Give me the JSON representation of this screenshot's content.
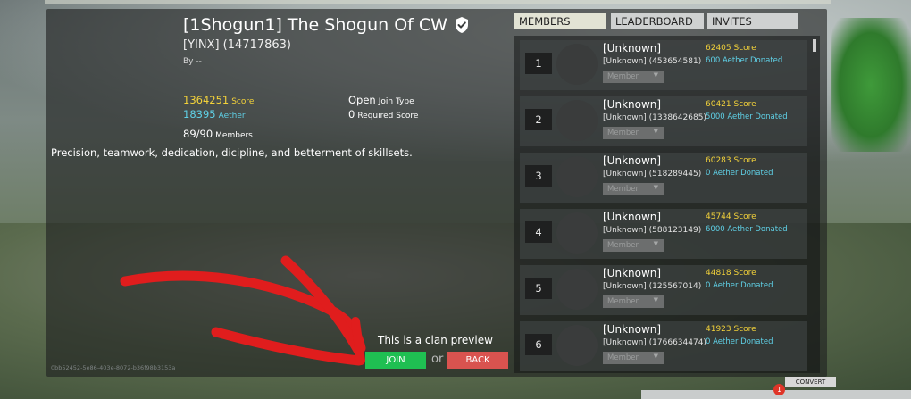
{
  "clan": {
    "title": "[1Shogun1] The Shogun Of CW",
    "tag_line": "[YINX] (14717863)",
    "by": "By --",
    "score_value": "1364251",
    "score_label": "Score",
    "aether_value": "18395",
    "aether_label": "Aether",
    "members_value": "89/90",
    "members_label": "Members",
    "join_type_value": "Open",
    "join_type_label": "Join Type",
    "required_value": "0",
    "required_label": "Required Score",
    "description": "Precision, teamwork, dedication, dicipline, and betterment of skillsets.",
    "guid": "0bb52452-5e86-403e-8072-b36f98b3153a"
  },
  "preview": {
    "text": "This is a clan preview",
    "join_label": "JOIN",
    "or_label": "or",
    "back_label": "BACK"
  },
  "tabs": [
    {
      "label": "MEMBERS"
    },
    {
      "label": "LEADERBOARD"
    },
    {
      "label": "INVITES"
    }
  ],
  "members": [
    {
      "rank": "1",
      "name": "[Unknown]",
      "id": "[Unknown] (453654581)",
      "score": "62405",
      "score_label": "Score",
      "aether": "600",
      "aether_label": "Aether Donated",
      "role": "Member"
    },
    {
      "rank": "2",
      "name": "[Unknown]",
      "id": "[Unknown] (1338642685)",
      "score": "60421",
      "score_label": "Score",
      "aether": "5000",
      "aether_label": "Aether Donated",
      "role": "Member"
    },
    {
      "rank": "3",
      "name": "[Unknown]",
      "id": "[Unknown] (518289445)",
      "score": "60283",
      "score_label": "Score",
      "aether": "0",
      "aether_label": "Aether Donated",
      "role": "Member"
    },
    {
      "rank": "4",
      "name": "[Unknown]",
      "id": "[Unknown] (588123149)",
      "score": "45744",
      "score_label": "Score",
      "aether": "6000",
      "aether_label": "Aether Donated",
      "role": "Member"
    },
    {
      "rank": "5",
      "name": "[Unknown]",
      "id": "[Unknown] (125567014)",
      "score": "44818",
      "score_label": "Score",
      "aether": "0",
      "aether_label": "Aether Donated",
      "role": "Member"
    },
    {
      "rank": "6",
      "name": "[Unknown]",
      "id": "[Unknown] (1766634474)",
      "score": "41923",
      "score_label": "Score",
      "aether": "0",
      "aether_label": "Aether Donated",
      "role": "Member"
    }
  ],
  "bottom": {
    "convert_label": "CONVERT",
    "notification_count": "1"
  },
  "colors": {
    "score": "#f3d23a",
    "aether": "#5fd0e6",
    "join": "#1fbf52",
    "back": "#d9534f",
    "annotation": "#e01d1d"
  },
  "icons": [
    "verified-shield-icon",
    "chevron-down-icon",
    "annotation-arrow"
  ]
}
